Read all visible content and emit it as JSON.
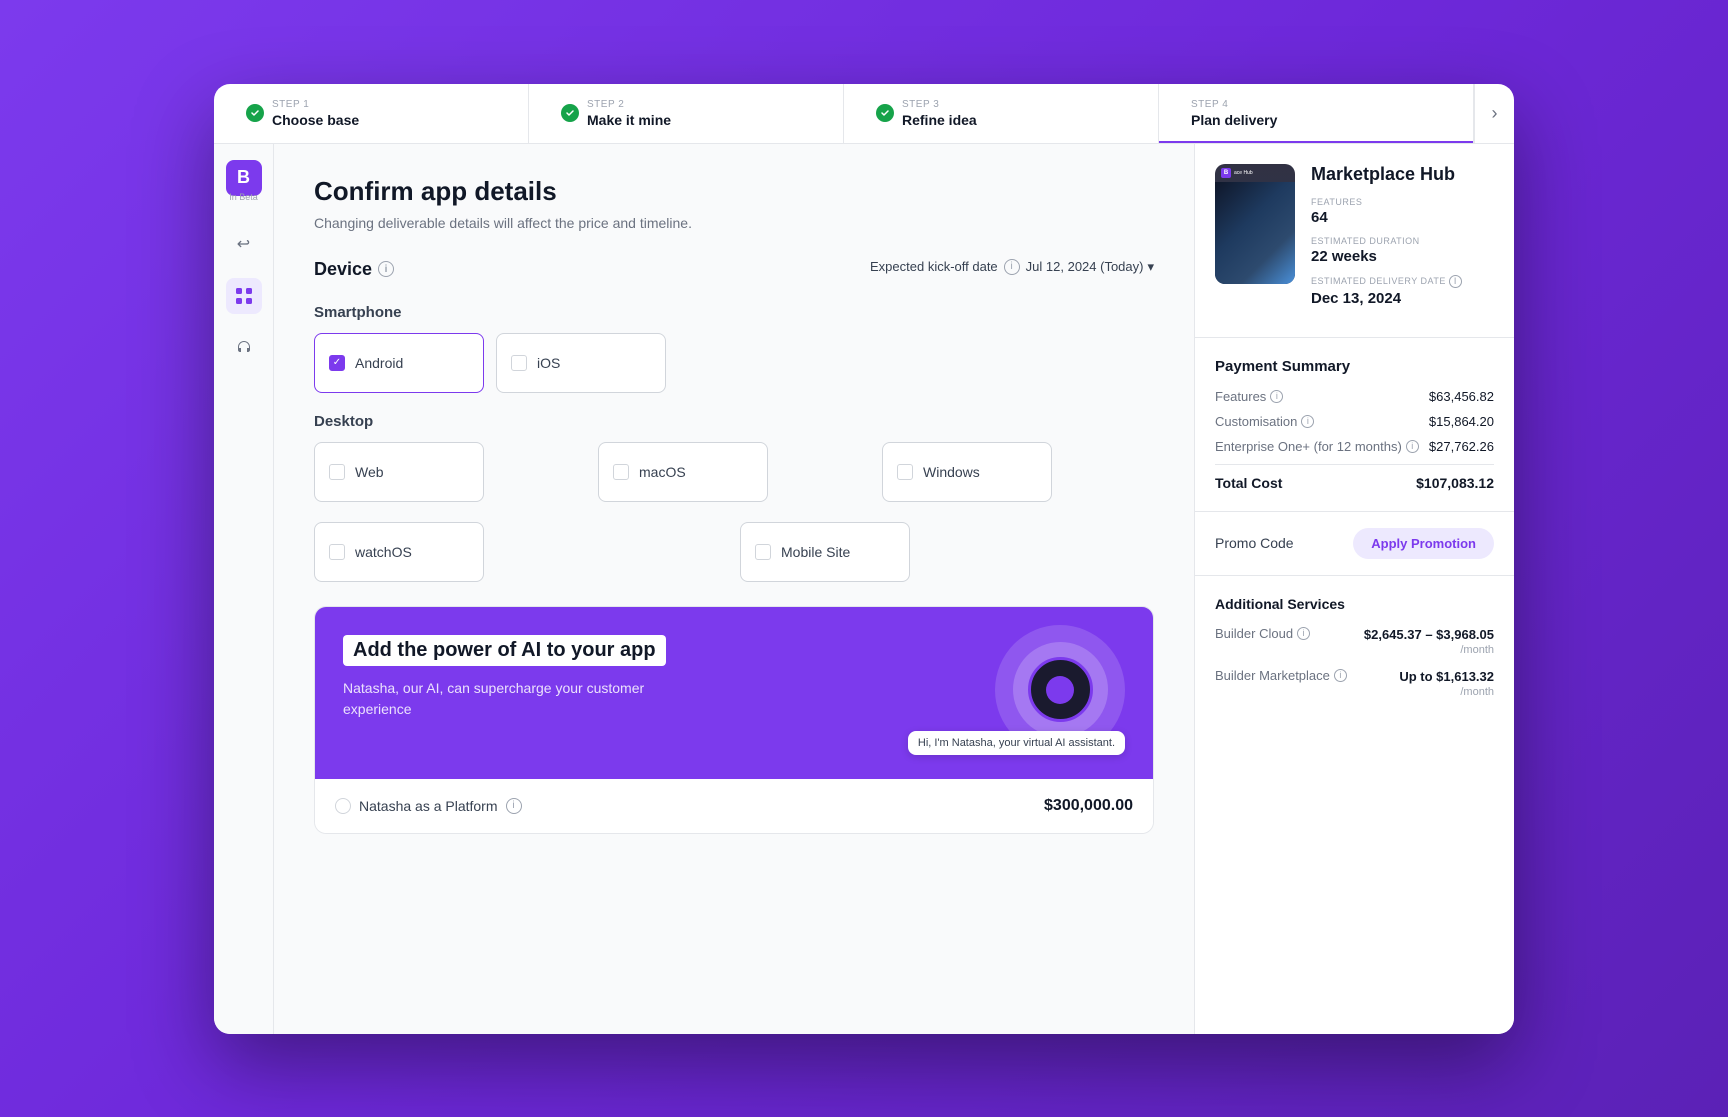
{
  "app": {
    "logo": "B",
    "beta_label": "In Beta"
  },
  "stepper": {
    "steps": [
      {
        "label": "STEP 1",
        "title": "Choose base",
        "completed": true,
        "active": false
      },
      {
        "label": "STEP 2",
        "title": "Make it mine",
        "completed": true,
        "active": false
      },
      {
        "label": "STEP 3",
        "title": "Refine idea",
        "completed": true,
        "active": false
      },
      {
        "label": "STEP 4",
        "title": "Plan delivery",
        "completed": false,
        "active": true
      }
    ]
  },
  "page": {
    "title": "Confirm app details",
    "subtitle": "Changing deliverable details will affect the price and timeline."
  },
  "device_section": {
    "label": "Device",
    "smartphone_label": "Smartphone",
    "android_label": "Android",
    "ios_label": "iOS",
    "desktop_label": "Desktop",
    "web_label": "Web",
    "macos_label": "macOS",
    "windows_label": "Windows",
    "watchos_label": "watchOS",
    "mobile_site_label": "Mobile Site"
  },
  "kickoff": {
    "label": "Expected kick-off date",
    "date": "Jul 12, 2024 (Today)"
  },
  "ai_banner": {
    "title": "Add the power of AI to your app",
    "description": "Natasha, our AI, can supercharge your customer experience",
    "bubble_text": "Hi, I'm Natasha, your virtual AI assistant.",
    "option_label": "Natasha as a Platform",
    "price": "$300,000.00"
  },
  "right_panel": {
    "app_name": "Marketplace Hub",
    "features_label": "FEATURES",
    "features_value": "64",
    "duration_label": "ESTIMATED DURATION",
    "duration_value": "22 weeks",
    "delivery_label": "ESTIMATED DELIVERY DATE",
    "delivery_value": "Dec 13, 2024",
    "payment_title": "Payment Summary",
    "features_cost_label": "Features",
    "features_cost": "$63,456.82",
    "customisation_label": "Customisation",
    "customisation_cost": "$15,864.20",
    "enterprise_label": "Enterprise One+ (for 12 months)",
    "enterprise_cost": "$27,762.26",
    "total_label": "Total Cost",
    "total_cost": "$107,083.12",
    "promo_label": "Promo Code",
    "promo_button": "Apply Promotion",
    "additional_title": "Additional Services",
    "builder_cloud_label": "Builder Cloud",
    "builder_cloud_price": "$2,645.37 – $3,968.05",
    "builder_cloud_period": "/month",
    "builder_marketplace_label": "Builder Marketplace",
    "builder_marketplace_price": "Up to $1,613.32",
    "builder_marketplace_period": "/month"
  },
  "sidebar": {
    "undo_icon": "↩",
    "grid_icon": "⊞",
    "headset_icon": "🎧"
  }
}
